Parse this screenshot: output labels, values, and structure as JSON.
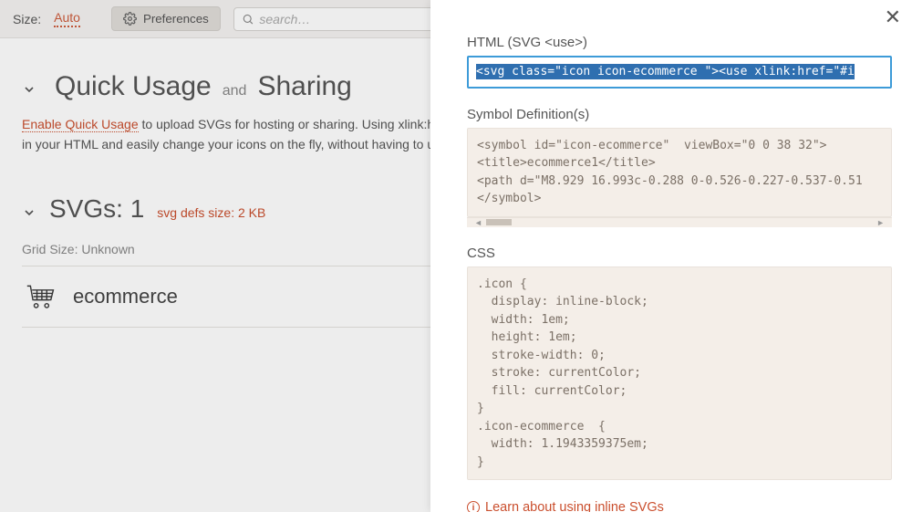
{
  "topbar": {
    "size_label": "Size:",
    "size_value": "Auto",
    "preferences": "Preferences",
    "search_placeholder": "search…"
  },
  "section1": {
    "title_a": "Quick Usage",
    "title_and": "and",
    "title_b": "Sharing",
    "enable_link": "Enable Quick Usage",
    "desc_rest": " to upload SVGs for hosting or sharing. Using xlink:href, you can reference SVGs in your HTML and easily change your icons on the fly, without having to update your CSS."
  },
  "section2": {
    "title": "SVGs: 1",
    "meta": "svg defs size: 2 KB",
    "grid_size": "Grid Size: Unknown"
  },
  "icon_item": {
    "label": "ecommerce"
  },
  "panel": {
    "h_html": "HTML (SVG <use>)",
    "code_html": "<svg class=\"icon icon-ecommerce \"><use xlink:href=\"#i",
    "h_symbol": "Symbol Definition(s)",
    "code_symbol": "<symbol id=\"icon-ecommerce\"  viewBox=\"0 0 38 32\">\n<title>ecommerce1</title>\n<path d=\"M8.929 16.993c-0.288 0-0.526-0.227-0.537-0.51\n</symbol>",
    "h_css": "CSS",
    "code_css": ".icon {\n  display: inline-block;\n  width: 1em;\n  height: 1em;\n  stroke-width: 0;\n  stroke: currentColor;\n  fill: currentColor;\n}\n.icon-ecommerce  {\n  width: 1.1943359375em;\n}",
    "learn": "Learn about using inline SVGs"
  }
}
